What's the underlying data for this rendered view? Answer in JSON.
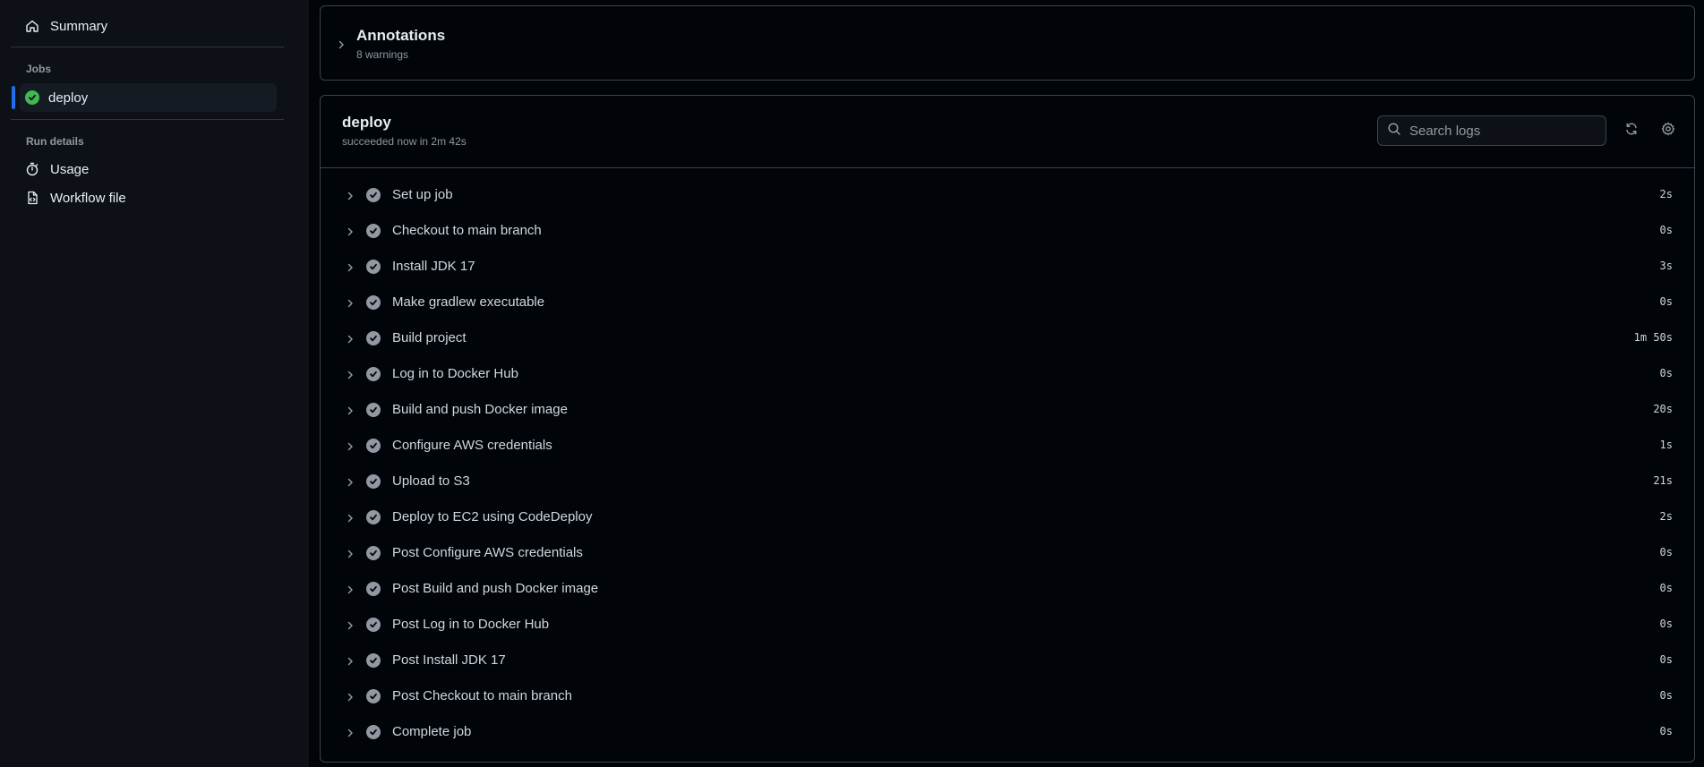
{
  "sidebar": {
    "summary_label": "Summary",
    "jobs_heading": "Jobs",
    "active_job_label": "deploy",
    "run_details_heading": "Run details",
    "usage_label": "Usage",
    "workflow_file_label": "Workflow file"
  },
  "annotations": {
    "title": "Annotations",
    "subtitle": "8 warnings"
  },
  "job": {
    "title": "deploy",
    "status": "succeeded now in 2m 42s",
    "search_placeholder": "Search logs",
    "steps": [
      {
        "name": "Set up job",
        "duration": "2s"
      },
      {
        "name": "Checkout to main branch",
        "duration": "0s"
      },
      {
        "name": "Install JDK 17",
        "duration": "3s"
      },
      {
        "name": "Make gradlew executable",
        "duration": "0s"
      },
      {
        "name": "Build project",
        "duration": "1m 50s"
      },
      {
        "name": "Log in to Docker Hub",
        "duration": "0s"
      },
      {
        "name": "Build and push Docker image",
        "duration": "20s"
      },
      {
        "name": "Configure AWS credentials",
        "duration": "1s"
      },
      {
        "name": "Upload to S3",
        "duration": "21s"
      },
      {
        "name": "Deploy to EC2 using CodeDeploy",
        "duration": "2s"
      },
      {
        "name": "Post Configure AWS credentials",
        "duration": "0s"
      },
      {
        "name": "Post Build and push Docker image",
        "duration": "0s"
      },
      {
        "name": "Post Log in to Docker Hub",
        "duration": "0s"
      },
      {
        "name": "Post Install JDK 17",
        "duration": "0s"
      },
      {
        "name": "Post Checkout to main branch",
        "duration": "0s"
      },
      {
        "name": "Complete job",
        "duration": "0s"
      }
    ]
  },
  "colors": {
    "success": "#3fb950",
    "step_check": "#9198a1",
    "accent": "#1f6feb",
    "background": "#010409",
    "sidebar_bg": "#0d1117"
  },
  "icons": {
    "summary": "home-icon",
    "job_status": "check-circle-icon",
    "usage": "stopwatch-icon",
    "workflow_file": "file-code-icon",
    "expand": "chevron-right-icon",
    "search": "search-icon",
    "refresh": "sync-icon",
    "settings": "gear-icon"
  }
}
